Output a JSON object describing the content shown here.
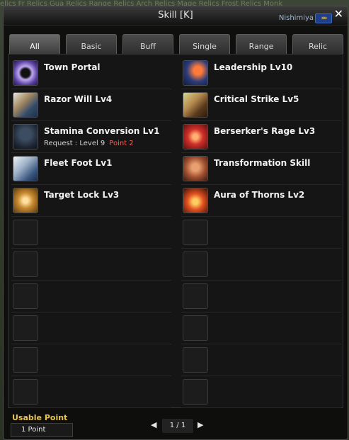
{
  "background_text": "elics Fr Relics Gua Relics Range Relics Arch Relics Mage Relics Frost Relics Monk",
  "window": {
    "title": "Skill [K]",
    "player_name": "Nishimiya",
    "player_icon": "»»",
    "close_label": "✕"
  },
  "tabs": [
    "All",
    "Basic",
    "Buff",
    "Single",
    "Range",
    "Relic"
  ],
  "active_tab": "All",
  "skills_left": [
    {
      "name": "Town Portal",
      "icon": "portal-icon"
    },
    {
      "name": "Razor Will Lv4",
      "icon": "razor-will-icon"
    },
    {
      "name": "Stamina Conversion Lv1",
      "icon": "stamina-icon",
      "request": "Request : Level  9",
      "point": "Point  2"
    },
    {
      "name": "Fleet Foot Lv1",
      "icon": "eagle-icon"
    },
    {
      "name": "Target Lock Lv3",
      "icon": "fist-icon"
    }
  ],
  "skills_right": [
    {
      "name": "Leadership Lv10",
      "icon": "leadership-icon"
    },
    {
      "name": "Critical Strike Lv5",
      "icon": "critical-strike-icon"
    },
    {
      "name": "Berserker's Rage Lv3",
      "icon": "berserker-icon"
    },
    {
      "name": "Transformation Skill",
      "icon": "transformation-icon"
    },
    {
      "name": "Aura of Thorns Lv2",
      "icon": "aura-icon"
    }
  ],
  "empty_slots_per_column": 6,
  "footer": {
    "usable_point_label": "Usable Point",
    "usable_point_value": "1 Point",
    "page_indicator": "1 / 1",
    "prev_label": "◀",
    "next_label": "▶"
  },
  "colors": {
    "accent_gold": "#e8c44a",
    "point_red": "#ff5a52"
  }
}
